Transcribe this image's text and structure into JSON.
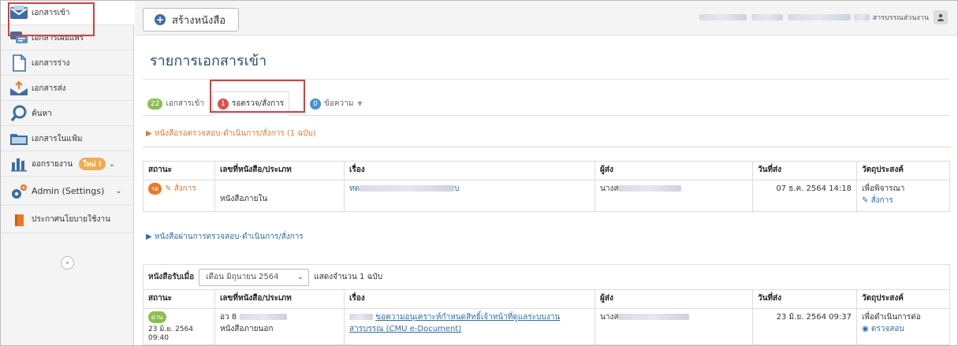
{
  "sidebar": {
    "items": [
      {
        "label": "เอกสารเข้า",
        "icon": "inbox-envelope-icon"
      },
      {
        "label": "เอกสารเผยแพร่",
        "icon": "chat-bubbles-icon"
      },
      {
        "label": "เอกสารร่าง",
        "icon": "draft-document-icon"
      },
      {
        "label": "เอกสารส่ง",
        "icon": "send-tray-icon"
      },
      {
        "label": "ค้นหา",
        "icon": "search-icon"
      },
      {
        "label": "เอกสารในแฟ้ม",
        "icon": "folder-icon"
      },
      {
        "label": "ออกรายงาน",
        "icon": "bar-chart-icon",
        "badge": "ใหม่ !"
      },
      {
        "label": "Admin (Settings)",
        "icon": "gears-icon"
      },
      {
        "label": "ประกาศนโยบายใช้งาน",
        "icon": "policy-book-icon"
      }
    ],
    "collapse": "«"
  },
  "topbar": {
    "create_label": "สร้างหนังสือ",
    "user_label": "สารบรรณส่วนงาน"
  },
  "page": {
    "title": "รายการเอกสารเข้า",
    "tabs": [
      {
        "count": "22",
        "label": "เอกสารเข้า",
        "color": "#8bbf4f"
      },
      {
        "count": "1",
        "label": "รอตรวจ/สั่งการ",
        "color": "#d9534f"
      },
      {
        "count": "0",
        "label": "ข้อความ",
        "color": "#4a8fd1"
      }
    ]
  },
  "pending": {
    "title": "▶ หนังสือรอตรวจสอบ-ดำเนินการ/สั่งการ (1 ฉบับ)",
    "columns": [
      "สถานะ",
      "เลขที่หนังสือ/ประเภท",
      "เรื่อง",
      "ผู้ส่ง",
      "วันที่ส่ง",
      "วัตถุประสงค์"
    ],
    "row": {
      "status_pill": "รอ",
      "status_action": "สั่งการ",
      "doc_type": "หนังสือภายใน",
      "subject_prefix": "ทด",
      "subject_suffix": "บ",
      "sender_prefix": "นางส",
      "date": "07 ธ.ค. 2564 14:18",
      "purpose": "เพื่อพิจารณา",
      "purpose_action": "สั่งการ"
    }
  },
  "processed": {
    "title": "▶ หนังสือผ่านการตรวจสอบ-ดำเนินการ/สั่งการ",
    "filter_label": "หนังสือรับเมื่อ",
    "filter_value": "เดือน มิถุนายน 2564",
    "filter_count": "แสดงจำนวน 1 ฉบับ",
    "columns": [
      "สถานะ",
      "เลขที่หนังสือ/ประเภท",
      "เรื่อง",
      "ผู้ส่ง",
      "วันที่ส่ง",
      "วัตถุประสงค์"
    ],
    "row": {
      "status_pill": "ผ่าน",
      "status_date": "23 มิ.ย. 2564 09:40",
      "doc_no_prefix": "อว 8",
      "doc_type": "หนังสือภายนอก",
      "subject_line1": "ขอความอนุเคราะห์กำหนดสิทธิ์เจ้าหน้าที่ดูแลระบบงาน",
      "subject_line2": "สารบรรณ (CMU e-Document)",
      "sender_prefix": "นางส",
      "date": "23 มิ.ย. 2564 09:37",
      "purpose": "เพื่อดำเนินการต่อ",
      "purpose_action": "ตรวจสอบ"
    }
  },
  "colors": {
    "accent": "#2a6fb4",
    "warning": "#e8792b",
    "highlight": "#e03b3b"
  }
}
